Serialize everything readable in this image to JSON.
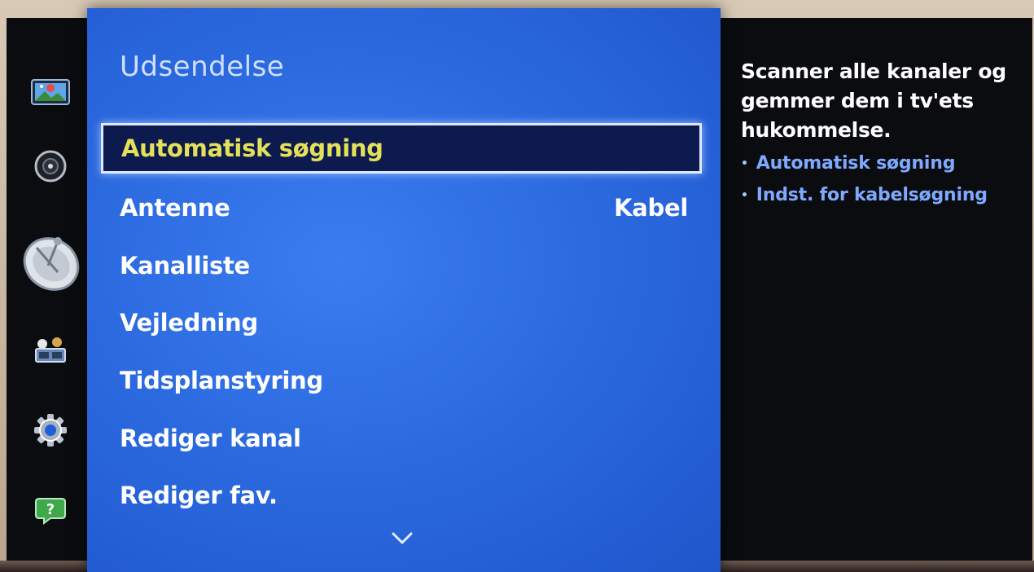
{
  "panel": {
    "title": "Udsendelse",
    "items": [
      {
        "label": "Automatisk søgning",
        "value": "",
        "selected": true
      },
      {
        "label": "Antenne",
        "value": "Kabel",
        "selected": false
      },
      {
        "label": "Kanalliste",
        "value": "",
        "selected": false
      },
      {
        "label": "Vejledning",
        "value": "",
        "selected": false
      },
      {
        "label": "Tidsplanstyring",
        "value": "",
        "selected": false
      },
      {
        "label": "Rediger kanal",
        "value": "",
        "selected": false
      },
      {
        "label": "Rediger fav.",
        "value": "",
        "selected": false
      }
    ],
    "scroll_icon": "chevron-down-icon"
  },
  "sidebar": {
    "icons": [
      "picture-icon",
      "sound-icon",
      "broadcast-satellite-icon",
      "network-icon",
      "settings-gear-icon",
      "support-help-icon"
    ]
  },
  "help": {
    "description": "Scanner alle kanaler og gemmer dem i tv'ets hukommelse.",
    "desc_lines": [
      "Scanner alle kanaler og",
      "gemmer dem i tv'ets",
      "hukommelse."
    ],
    "links": [
      "Automatisk søgning",
      "Indst. for kabelsøgning"
    ]
  },
  "colors": {
    "panel_blue": "#2c6ae0",
    "selected_text": "#e5e05a",
    "help_link": "#7fa9ff"
  }
}
